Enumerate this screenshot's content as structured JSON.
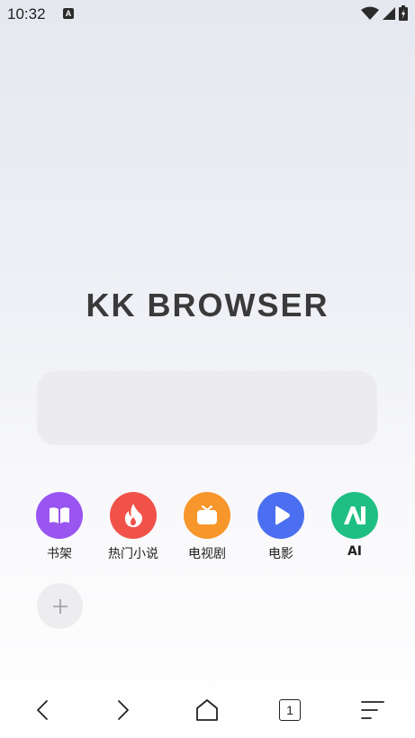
{
  "status_bar": {
    "time": "10:32",
    "notification_icon": "a-icon",
    "icons": [
      "wifi-icon",
      "signal-icon",
      "battery-icon"
    ]
  },
  "brand": {
    "title": "KK BROWSER"
  },
  "search": {
    "placeholder": ""
  },
  "shortcuts": [
    {
      "label": "书架",
      "icon": "book-icon",
      "color": "#9a55f0"
    },
    {
      "label": "热门小说",
      "icon": "flame-icon",
      "color": "#f0524a"
    },
    {
      "label": "电视剧",
      "icon": "tv-icon",
      "color": "#f7962b"
    },
    {
      "label": "电影",
      "icon": "play-icon",
      "color": "#4b6ff0"
    },
    {
      "label": "AI",
      "icon": "ai-icon",
      "color": "#1fbf84"
    }
  ],
  "add_shortcut": {
    "icon": "plus-icon"
  },
  "bottom_nav": {
    "back_icon": "chevron-left-icon",
    "forward_icon": "chevron-right-icon",
    "home_icon": "home-icon",
    "tab_count": "1",
    "menu_icon": "menu-icon"
  }
}
